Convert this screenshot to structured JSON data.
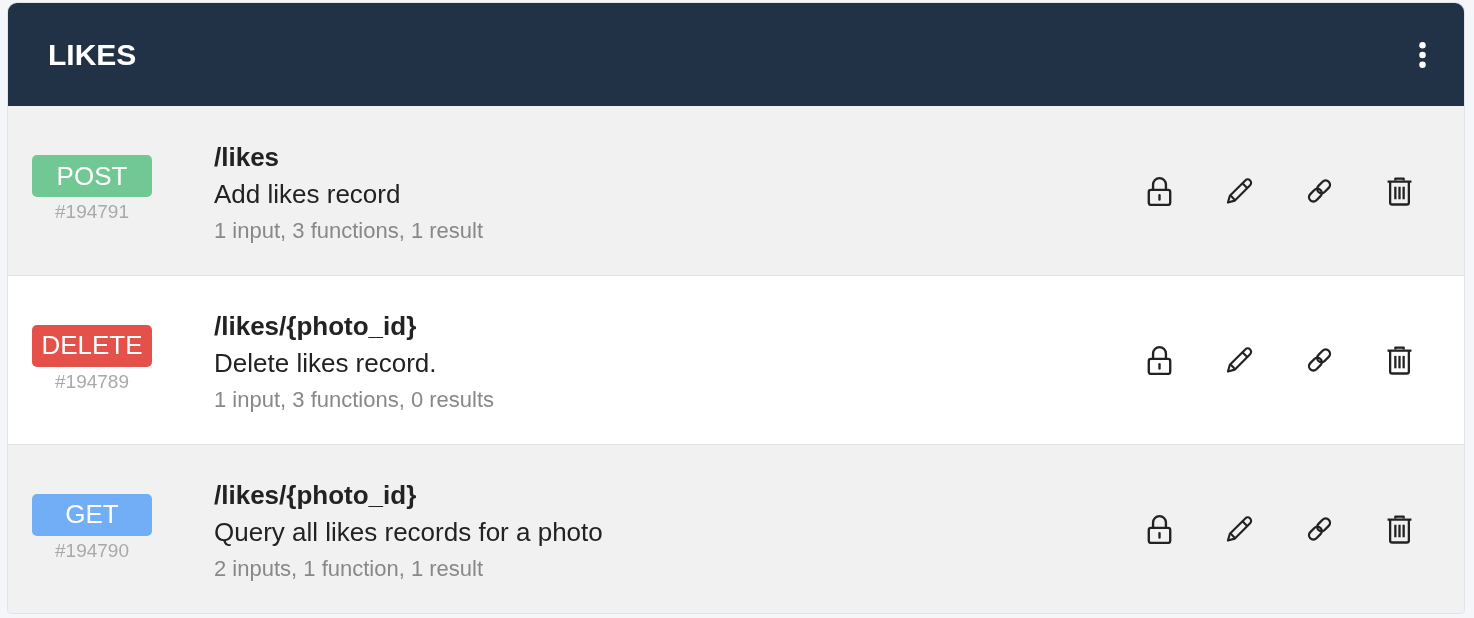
{
  "panel": {
    "title": "LIKES"
  },
  "endpoints": [
    {
      "method": "POST",
      "color": "#72c895",
      "id": "#194791",
      "path": "/likes",
      "description": "Add likes record",
      "summary": "1 input, 3 functions, 1 result"
    },
    {
      "method": "DELETE",
      "color": "#e4504a",
      "id": "#194789",
      "path": "/likes/{photo_id}",
      "description": "Delete likes record.",
      "summary": "1 input, 3 functions, 0 results"
    },
    {
      "method": "GET",
      "color": "#72aef5",
      "id": "#194790",
      "path": "/likes/{photo_id}",
      "description": "Query all likes records for a photo",
      "summary": "2 inputs, 1 function, 1 result"
    }
  ]
}
